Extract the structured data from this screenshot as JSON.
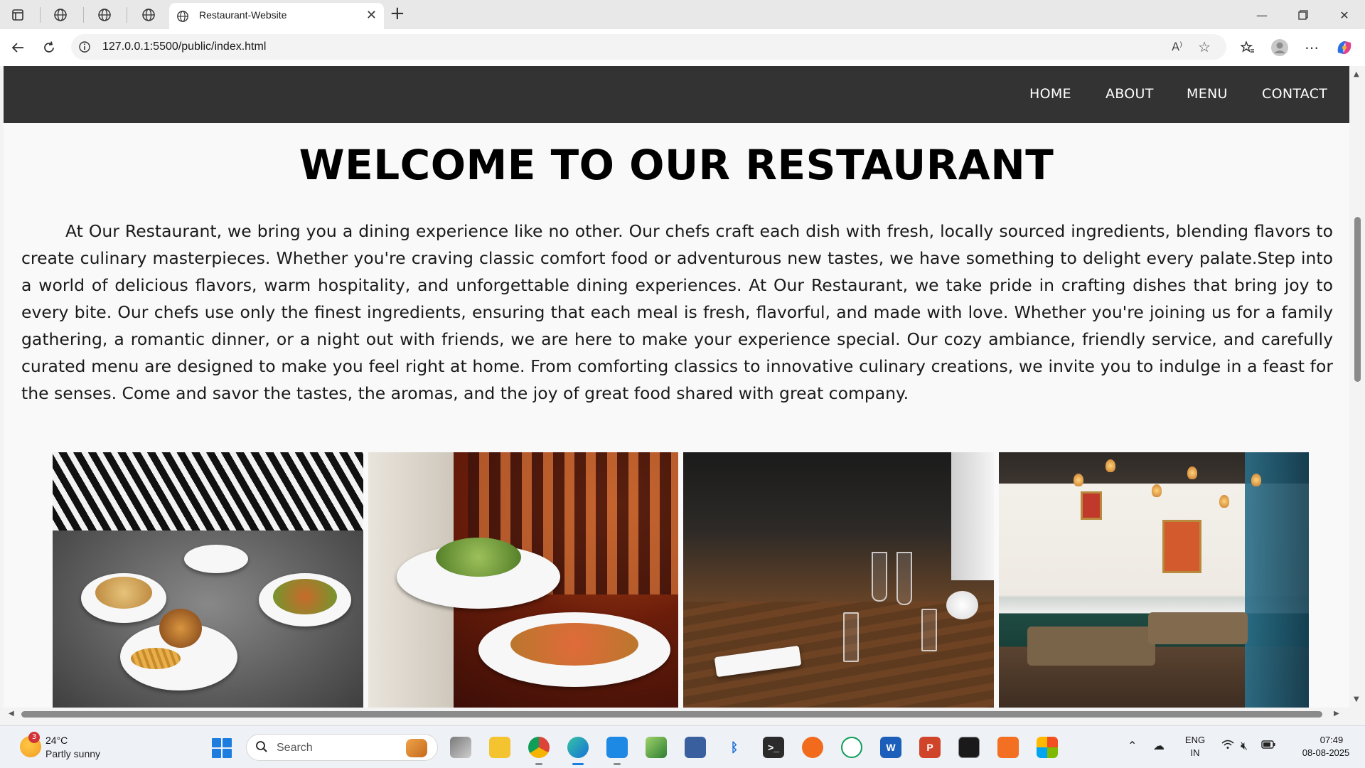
{
  "browser": {
    "tab_title": "Restaurant-Website",
    "url": "127.0.0.1:5500/public/index.html",
    "read_aloud_label": "A⁾"
  },
  "site": {
    "nav": [
      "HOME",
      "ABOUT",
      "MENU",
      "CONTACT"
    ],
    "heading": "WELCOME TO OUR RESTAURANT",
    "intro": "At Our Restaurant, we bring you a dining experience like no other. Our chefs craft each dish with fresh, locally sourced ingredients, blending flavors to create culinary masterpieces. Whether you're craving classic comfort food or adventurous new tastes, we have something to delight every palate.Step into a world of delicious flavors, warm hospitality, and unforgettable dining experiences. At Our Restaurant, we take pride in crafting dishes that bring joy to every bite. Our chefs use only the finest ingredients, ensuring that each meal is fresh, flavorful, and made with love. Whether you're joining us for a family gathering, a romantic dinner, or a night out with friends, we are here to make your experience special. Our cozy ambiance, friendly service, and carefully curated menu are designed to make you feel right at home. From comforting classics to innovative culinary creations, we invite you to indulge in a feast for the senses. Come and savor the tastes, the aromas, and the joy of great food shared with great company."
  },
  "taskbar": {
    "weather_temp": "24°C",
    "weather_desc": "Partly sunny",
    "weather_badge": "3",
    "search_placeholder": "Search",
    "lang_top": "ENG",
    "lang_bottom": "IN",
    "time": "07:49",
    "date": "08-08-2025",
    "word_letter": "W",
    "ppt_letter": "P"
  },
  "colors": {
    "nav_bg": "#333333",
    "page_bg": "#f9f9f9",
    "accent": "#1d7ee0"
  }
}
